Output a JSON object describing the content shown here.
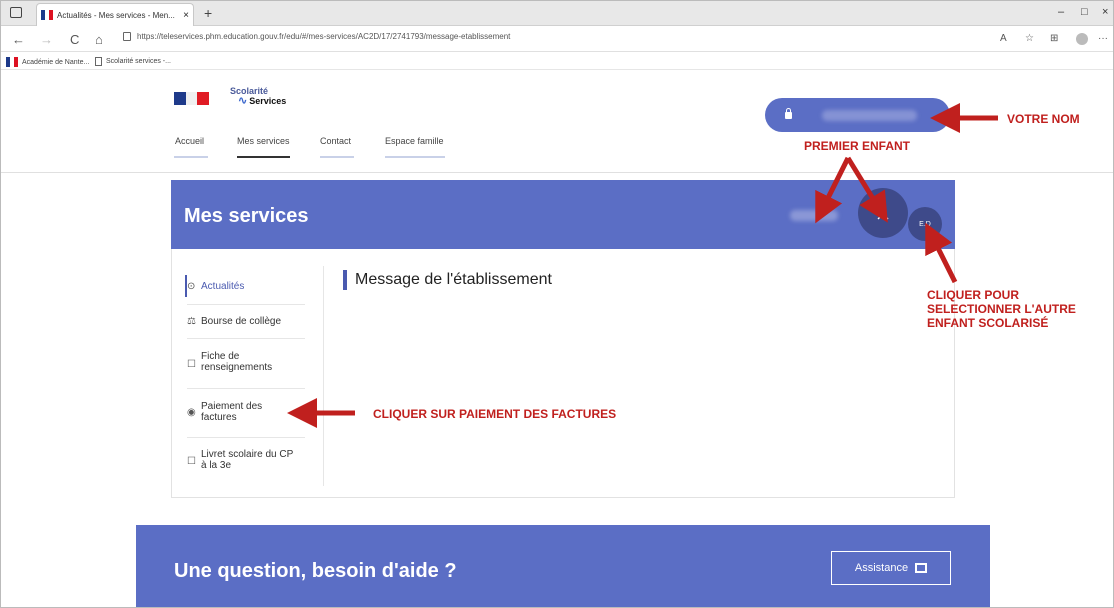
{
  "browser": {
    "tab_title": "Actualités - Mes services - Men...",
    "tab_close": "×",
    "new_tab": "+",
    "back": "←",
    "forward": "→",
    "reload": "C",
    "home": "⌂",
    "url": "https://teleservices.phm.education.gouv.fr/edu/#/mes-services/AC2D/17/2741793/message-etablissement",
    "bookmarks": [
      "Académie de Nante...",
      "Scolarité services -..."
    ],
    "minimize": "–",
    "maximize": "□",
    "close": "×",
    "more": "···",
    "toolbar_icons": [
      "A",
      "☆",
      "⊞"
    ]
  },
  "header": {
    "brand_line1": "Scolarité",
    "brand_line2": "Services",
    "nav": [
      "Accueil",
      "Mes services",
      "Contact",
      "Espace famille"
    ]
  },
  "services": {
    "title": "Mes services",
    "avatar_initials": "E.D",
    "avatar_main_icon": "person-icon",
    "sidebar": [
      {
        "label": "Actualités",
        "icon": "⊙"
      },
      {
        "label": "Bourse de collège",
        "icon": "⚖"
      },
      {
        "label": "Fiche de renseignements",
        "icon": "☐"
      },
      {
        "label": "Paiement des factures",
        "icon": "◉"
      },
      {
        "label": "Livret scolaire du CP à la 3e",
        "icon": "☐"
      }
    ],
    "message_title": "Message de l'établissement"
  },
  "help": {
    "title": "Une question, besoin d'aide ?",
    "button_label": "Assistance"
  },
  "annotations": {
    "votre_nom": "VOTRE NOM",
    "premier_enfant": "PREMIER ENFANT",
    "cliquer_pour_l1": "CLIQUER POUR",
    "cliquer_pour_l2": "SELECTIONNER L'AUTRE",
    "cliquer_pour_l3": "ENFANT SCOLARISÉ",
    "paiement": "CLIQUER SUR PAIEMENT DES FACTURES",
    "color": "#c0201e"
  },
  "colors": {
    "brand_blue": "#5b6ec5",
    "avatar_dark": "#3e4a8a"
  }
}
